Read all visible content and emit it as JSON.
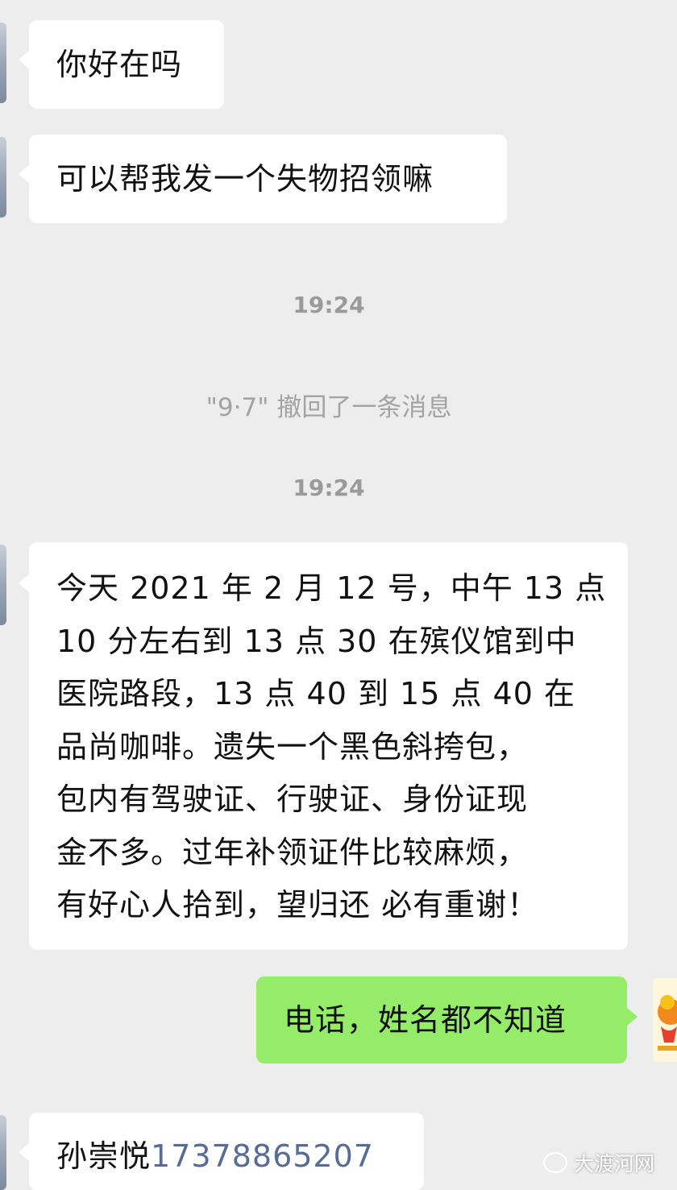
{
  "messages": [
    {
      "text": "你好在吗"
    },
    {
      "text": "可以帮我发一个失物招领嘛"
    },
    {
      "time": "19:24"
    },
    {
      "recall": "\"9·7\" 撤回了一条消息"
    },
    {
      "time": "19:24"
    },
    {
      "lines": [
        "今天 2021 年 2 月 12 号，中午 13 点",
        "10 分左右到 13 点 30 在殡仪馆到中",
        "医院路段，13 点 40 到 15 点 40 在",
        "品尚咖啡。遗失一个黑色斜挎包，",
        "包内有驾驶证、行驶证、身份证现",
        "金不多。过年补领证件比较麻烦，",
        "有好心人拾到，望归还  必有重谢！"
      ]
    },
    {
      "text": "电话，姓名都不知道"
    },
    {
      "name": "孙崇悦",
      "phone": "17378865207"
    }
  ],
  "watermark": "大渡河网",
  "colors": {
    "background": "#ededed",
    "incoming_bubble": "#ffffff",
    "outgoing_bubble": "#95ec69",
    "phone_link": "#576b95",
    "timestamp": "#9a9a9a"
  },
  "icons": [
    "sender-avatar",
    "self-avatar",
    "wechat-channel-icon"
  ]
}
